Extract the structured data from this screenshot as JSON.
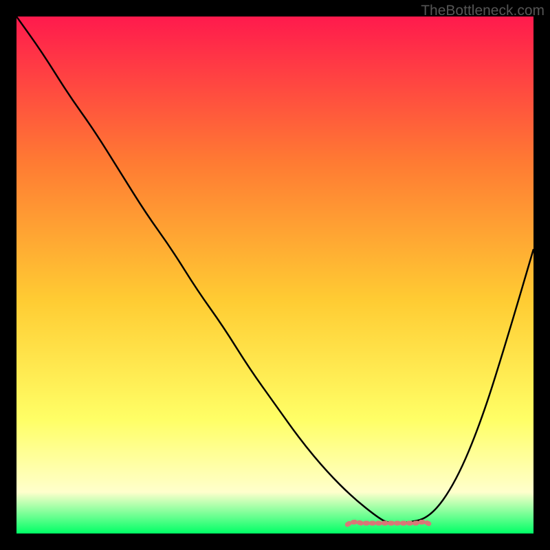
{
  "watermark": "TheBottleneck.com",
  "chart_data": {
    "type": "line",
    "title": "",
    "xlabel": "",
    "ylabel": "",
    "xlim": [
      0,
      100
    ],
    "ylim": [
      0,
      100
    ],
    "gradient_colors": {
      "top": "#ff1a4d",
      "mid_upper": "#ff7a33",
      "mid": "#ffcc33",
      "mid_lower": "#ffff66",
      "lower": "#ffffcc",
      "bottom": "#00ff66"
    },
    "series": [
      {
        "name": "bottleneck-curve",
        "color": "#000000",
        "x": [
          0,
          5,
          10,
          15,
          20,
          25,
          30,
          35,
          40,
          45,
          50,
          55,
          60,
          65,
          70,
          72,
          75,
          80,
          85,
          90,
          95,
          100
        ],
        "y": [
          100,
          93,
          85,
          78,
          70,
          62,
          55,
          47,
          40,
          32,
          25,
          18,
          12,
          7,
          3,
          2,
          2,
          3,
          10,
          22,
          38,
          55
        ]
      }
    ],
    "valley_marker": {
      "name": "optimal-range",
      "color": "#d97777",
      "x_range": [
        64,
        80
      ],
      "y": 2
    }
  }
}
